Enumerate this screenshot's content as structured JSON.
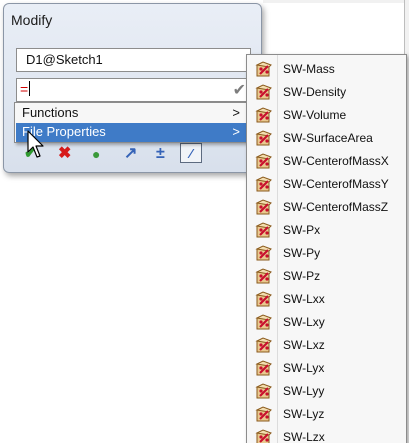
{
  "dialog": {
    "title": "Modify",
    "name_value": "D1@Sketch1",
    "value_text": "="
  },
  "context_menu": {
    "items": [
      {
        "label": "Functions",
        "arrow": ">"
      },
      {
        "label": "File Properties",
        "arrow": ">"
      }
    ]
  },
  "submenu": {
    "items": [
      "SW-Mass",
      "SW-Density",
      "SW-Volume",
      "SW-SurfaceArea",
      "SW-CenterofMassX",
      "SW-CenterofMassY",
      "SW-CenterofMassZ",
      "SW-Px",
      "SW-Py",
      "SW-Pz",
      "SW-Lxx",
      "SW-Lxy",
      "SW-Lxz",
      "SW-Lyx",
      "SW-Lyy",
      "SW-Lyz",
      "SW-Lzx"
    ],
    "icon": "property-icon"
  },
  "colors": {
    "menu_highlight": "#3f7bc7",
    "value_text": "#d00000",
    "dialog_bg": "#dfe6f0"
  }
}
